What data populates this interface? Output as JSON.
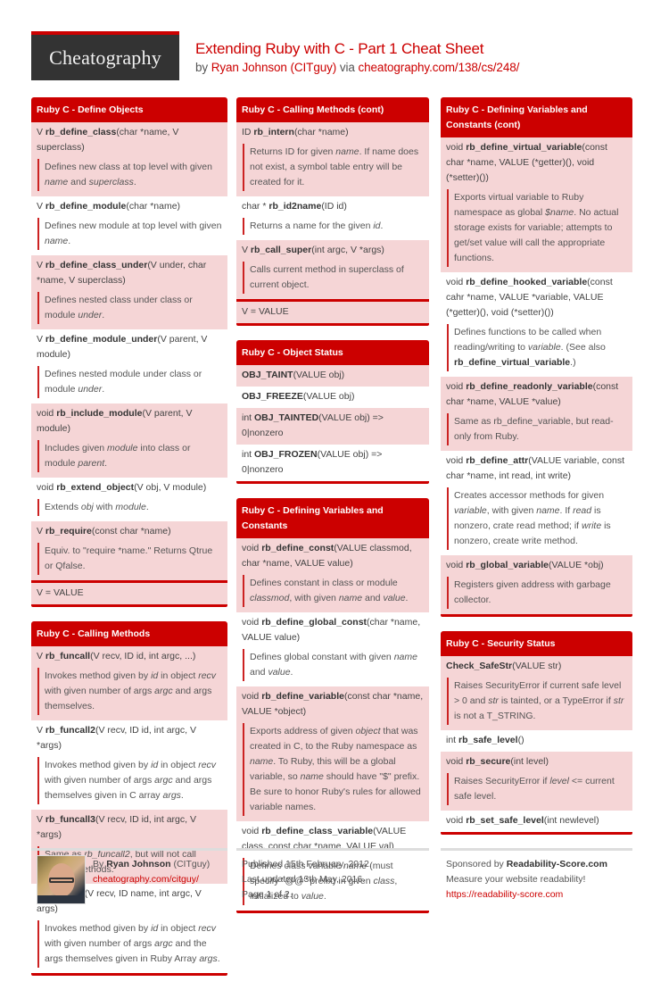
{
  "header": {
    "logo_text": "Cheatography",
    "title": "Extending Ruby with C - Part 1 Cheat Sheet",
    "by_label": "by",
    "author": "Ryan Johnson (CITguy)",
    "via_label": "via",
    "url": "cheatography.com/138/cs/248/"
  },
  "colors": {
    "accent": "#cc0000",
    "row_alt": "#f5d5d6",
    "logo_bg": "#333333"
  },
  "columns": [
    [
      {
        "title": "Ruby C - Define Objects",
        "rows": [
          {
            "pre": "V ",
            "fn": "rb_define_class",
            "args": "(char *name, V superclass)",
            "desc": [
              [
                "Defines new class at top level with given ",
                ""
              ],
              [
                "name",
                "i"
              ],
              [
                " and ",
                ""
              ],
              [
                "superclass",
                "i"
              ],
              [
                ".",
                ""
              ]
            ]
          },
          {
            "pre": "V ",
            "fn": "rb_define_module",
            "args": "(char *name)",
            "desc": [
              [
                "Defines new module at top level with given ",
                ""
              ],
              [
                "name",
                "i"
              ],
              [
                ".",
                ""
              ]
            ]
          },
          {
            "pre": "V ",
            "fn": "rb_define_class_under",
            "args": "(V under, char *name, V superclass)",
            "desc": [
              [
                "Defines nested class under class or module ",
                ""
              ],
              [
                "under",
                "i"
              ],
              [
                ".",
                ""
              ]
            ]
          },
          {
            "pre": "V ",
            "fn": "rb_define_module_under",
            "args": "(V parent, V module)",
            "desc": [
              [
                "Defines nested module under class or module ",
                ""
              ],
              [
                "under",
                "i"
              ],
              [
                ".",
                ""
              ]
            ]
          },
          {
            "pre": "void ",
            "fn": "rb_include_module",
            "args": "(V parent, V module)",
            "desc": [
              [
                "Includes given ",
                ""
              ],
              [
                "module",
                "i"
              ],
              [
                " into class or module ",
                ""
              ],
              [
                "parent",
                "i"
              ],
              [
                ".",
                ""
              ]
            ]
          },
          {
            "pre": "void ",
            "fn": "rb_extend_object",
            "args": "(V obj, V module)",
            "desc": [
              [
                "Extends ",
                ""
              ],
              [
                "obj",
                "i"
              ],
              [
                " with ",
                ""
              ],
              [
                "module",
                "i"
              ],
              [
                ".",
                ""
              ]
            ]
          },
          {
            "pre": "V ",
            "fn": "rb_require",
            "args": "(const char *name)",
            "desc": [
              [
                "Equiv. to \"require *name.\" Returns Qtrue or Qfalse.",
                ""
              ]
            ]
          }
        ],
        "footer": "V = VALUE"
      },
      {
        "title": "Ruby C - Calling Methods",
        "rows": [
          {
            "pre": "V ",
            "fn": "rb_funcall",
            "args": "(V recv, ID id, int argc, ...)",
            "desc": [
              [
                "Invokes method given by ",
                ""
              ],
              [
                "id",
                "i"
              ],
              [
                " in object ",
                ""
              ],
              [
                "recv",
                "i"
              ],
              [
                " with given number of args ",
                ""
              ],
              [
                "argc",
                "i"
              ],
              [
                " and args themselves.",
                ""
              ]
            ]
          },
          {
            "pre": "V ",
            "fn": "rb_funcall2",
            "args": "(V recv, ID id, int argc, V *args)",
            "desc": [
              [
                "Invokes method given by ",
                ""
              ],
              [
                "id",
                "i"
              ],
              [
                " in object ",
                ""
              ],
              [
                "recv",
                "i"
              ],
              [
                " with given number of args ",
                ""
              ],
              [
                "argc",
                "i"
              ],
              [
                " and args themselves given in C array ",
                ""
              ],
              [
                "args",
                "i"
              ],
              [
                ".",
                ""
              ]
            ]
          },
          {
            "pre": "V ",
            "fn": "rb_funcall3",
            "args": "(V recv, ID id, int argc, V *args)",
            "desc": [
              [
                "Same as ",
                ""
              ],
              [
                "rb_funcall2",
                "i"
              ],
              [
                ", but will not call private methods.",
                ""
              ]
            ]
          },
          {
            "pre": "V ",
            "fn": "rb_apply",
            "args": "(V recv, ID name, int argc, V args)",
            "desc": [
              [
                "Invokes method given by ",
                ""
              ],
              [
                "id",
                "i"
              ],
              [
                " in object ",
                ""
              ],
              [
                "recv",
                "i"
              ],
              [
                " with given number of args ",
                ""
              ],
              [
                "argc",
                "i"
              ],
              [
                " and the args themselves given in Ruby Array ",
                ""
              ],
              [
                "args",
                "i"
              ],
              [
                ".",
                ""
              ]
            ]
          }
        ]
      }
    ],
    [
      {
        "title": "Ruby C - Calling Methods (cont)",
        "rows": [
          {
            "pre": "ID ",
            "fn": "rb_intern",
            "args": "(char *name)",
            "desc": [
              [
                "Returns ID for given ",
                ""
              ],
              [
                "name",
                "i"
              ],
              [
                ". If name does not exist, a symbol table entry will be created for it.",
                ""
              ]
            ]
          },
          {
            "pre": "char * ",
            "fn": "rb_id2name",
            "args": "(ID id)",
            "desc": [
              [
                "Returns a name for the given ",
                ""
              ],
              [
                "id",
                "i"
              ],
              [
                ".",
                ""
              ]
            ]
          },
          {
            "pre": "V ",
            "fn": "rb_call_super",
            "args": "(int argc, V *args)",
            "desc": [
              [
                "Calls current method in superclass of current object.",
                ""
              ]
            ]
          }
        ],
        "footer": "V = VALUE"
      },
      {
        "title": "Ruby C - Object Status",
        "rows": [
          {
            "pre": "",
            "fn": "OBJ_TAINT",
            "args": "(VALUE obj)"
          },
          {
            "pre": "",
            "fn": "OBJ_FREEZE",
            "args": "(VALUE obj)"
          },
          {
            "pre": "int ",
            "fn": "OBJ_TAINTED",
            "args": "(VALUE obj) => 0|nonzero"
          },
          {
            "pre": "int ",
            "fn": "OBJ_FROZEN",
            "args": "(VALUE obj) => 0|nonzero"
          }
        ]
      },
      {
        "title": "Ruby C - Defining Variables and Constants",
        "rows": [
          {
            "pre": "void ",
            "fn": "rb_define_const",
            "args": "(VALUE classmod, char *name, VALUE value)",
            "desc": [
              [
                "Defines constant in class or module ",
                ""
              ],
              [
                "classmod",
                "i"
              ],
              [
                ", with given ",
                ""
              ],
              [
                "name",
                "i"
              ],
              [
                " and ",
                ""
              ],
              [
                "value",
                "i"
              ],
              [
                ".",
                ""
              ]
            ]
          },
          {
            "pre": "void ",
            "fn": "rb_define_global_const",
            "args": "(char *name, VALUE value)",
            "desc": [
              [
                "Defines global constant with given ",
                ""
              ],
              [
                "name",
                "i"
              ],
              [
                " and ",
                ""
              ],
              [
                "value",
                "i"
              ],
              [
                ".",
                ""
              ]
            ]
          },
          {
            "pre": "void ",
            "fn": "rb_define_variable",
            "args": "(const char *name, VALUE *object)",
            "desc": [
              [
                "Exports address of given ",
                ""
              ],
              [
                "object",
                "i"
              ],
              [
                " that was created in C, to the Ruby namespace as ",
                ""
              ],
              [
                "name",
                "i"
              ],
              [
                ". To Ruby, this will be a global variable, so ",
                ""
              ],
              [
                "name",
                "i"
              ],
              [
                " should have \"$\" prefix. Be sure to honor Ruby's rules for allowed variable names.",
                ""
              ]
            ]
          },
          {
            "pre": "void ",
            "fn": "rb_define_class_variable",
            "args": "(VALUE class, const char *name, VALUE val)",
            "desc": [
              [
                "Defines class variable ",
                ""
              ],
              [
                "name",
                "i"
              ],
              [
                " (must specify \"@@\" prefix) in given ",
                ""
              ],
              [
                "class",
                "i"
              ],
              [
                ", initialized to ",
                ""
              ],
              [
                "value",
                "i"
              ],
              [
                ".",
                ""
              ]
            ]
          }
        ]
      }
    ],
    [
      {
        "title": "Ruby C - Defining Variables and Constants (cont)",
        "rows": [
          {
            "pre": "void ",
            "fn": "rb_define_virtual_variable",
            "args": "(const char *name, VALUE (*getter)(), void (*setter)())",
            "desc": [
              [
                "Exports virtual variable to Ruby namespace as global ",
                ""
              ],
              [
                "$name",
                "i"
              ],
              [
                ". No actual storage exists for variable; attempts to get/set value will call the appropriate functions.",
                ""
              ]
            ]
          },
          {
            "pre": "void ",
            "fn": "rb_define_hooked_variable",
            "args": "(const cahr *name, VALUE *variable, VALUE (*getter)(), void (*setter)())",
            "desc": [
              [
                "Defines functions to be called when reading/writing to ",
                ""
              ],
              [
                "variable",
                "i"
              ],
              [
                ". (See also ",
                ""
              ],
              [
                "rb_define_virtual_variable",
                "b"
              ],
              [
                ".)",
                ""
              ]
            ]
          },
          {
            "pre": "void ",
            "fn": "rb_define_readonly_variable",
            "args": "(const char *name, VALUE *value)",
            "desc": [
              [
                "Same as rb_define_variable, but read-only from Ruby.",
                ""
              ]
            ]
          },
          {
            "pre": "void ",
            "fn": "rb_define_attr",
            "args": "(VALUE variable, const char *name, int read, int write)",
            "desc": [
              [
                "Creates accessor methods for given ",
                ""
              ],
              [
                "variable",
                "i"
              ],
              [
                ", with given ",
                ""
              ],
              [
                "name",
                "i"
              ],
              [
                ". If ",
                ""
              ],
              [
                "read",
                "i"
              ],
              [
                " is nonzero, crate read method; if ",
                ""
              ],
              [
                "write",
                "i"
              ],
              [
                " is nonzero, create write method.",
                ""
              ]
            ]
          },
          {
            "pre": "void ",
            "fn": "rb_global_variable",
            "args": "(VALUE *obj)",
            "desc": [
              [
                "Registers given address with garbage collector.",
                ""
              ]
            ]
          }
        ]
      },
      {
        "title": "Ruby C - Security Status",
        "rows": [
          {
            "pre": "",
            "fn": "Check_SafeStr",
            "args": "(VALUE str)",
            "desc": [
              [
                "Raises SecurityError if current safe level > 0 and ",
                ""
              ],
              [
                "str",
                "i"
              ],
              [
                " is tainted, or a TypeError if ",
                ""
              ],
              [
                "str",
                "i"
              ],
              [
                " is not a T_STRING.",
                ""
              ]
            ]
          },
          {
            "pre": "int ",
            "fn": "rb_safe_level",
            "args": "()"
          },
          {
            "pre": "void ",
            "fn": "rb_secure",
            "args": "(int level)",
            "desc": [
              [
                "Raises SecurityError if ",
                ""
              ],
              [
                "level",
                "i"
              ],
              [
                " <= current safe level.",
                ""
              ]
            ]
          },
          {
            "pre": "void ",
            "fn": "rb_set_safe_level",
            "args": "(int newlevel)"
          }
        ]
      }
    ]
  ],
  "footer": {
    "author": {
      "by_label": "By",
      "name": "Ryan Johnson",
      "handle": "(CITguy)",
      "link": "cheatography.com/citguy/"
    },
    "published": "Published 15th February, 2012.",
    "updated": "Last updated 13th May, 2016.",
    "page": "Page 1 of 2.",
    "sponsor": {
      "label": "Sponsored by",
      "name": "Readability-Score.com",
      "tagline": "Measure your website readability!",
      "link": "https://readability-score.com"
    }
  }
}
